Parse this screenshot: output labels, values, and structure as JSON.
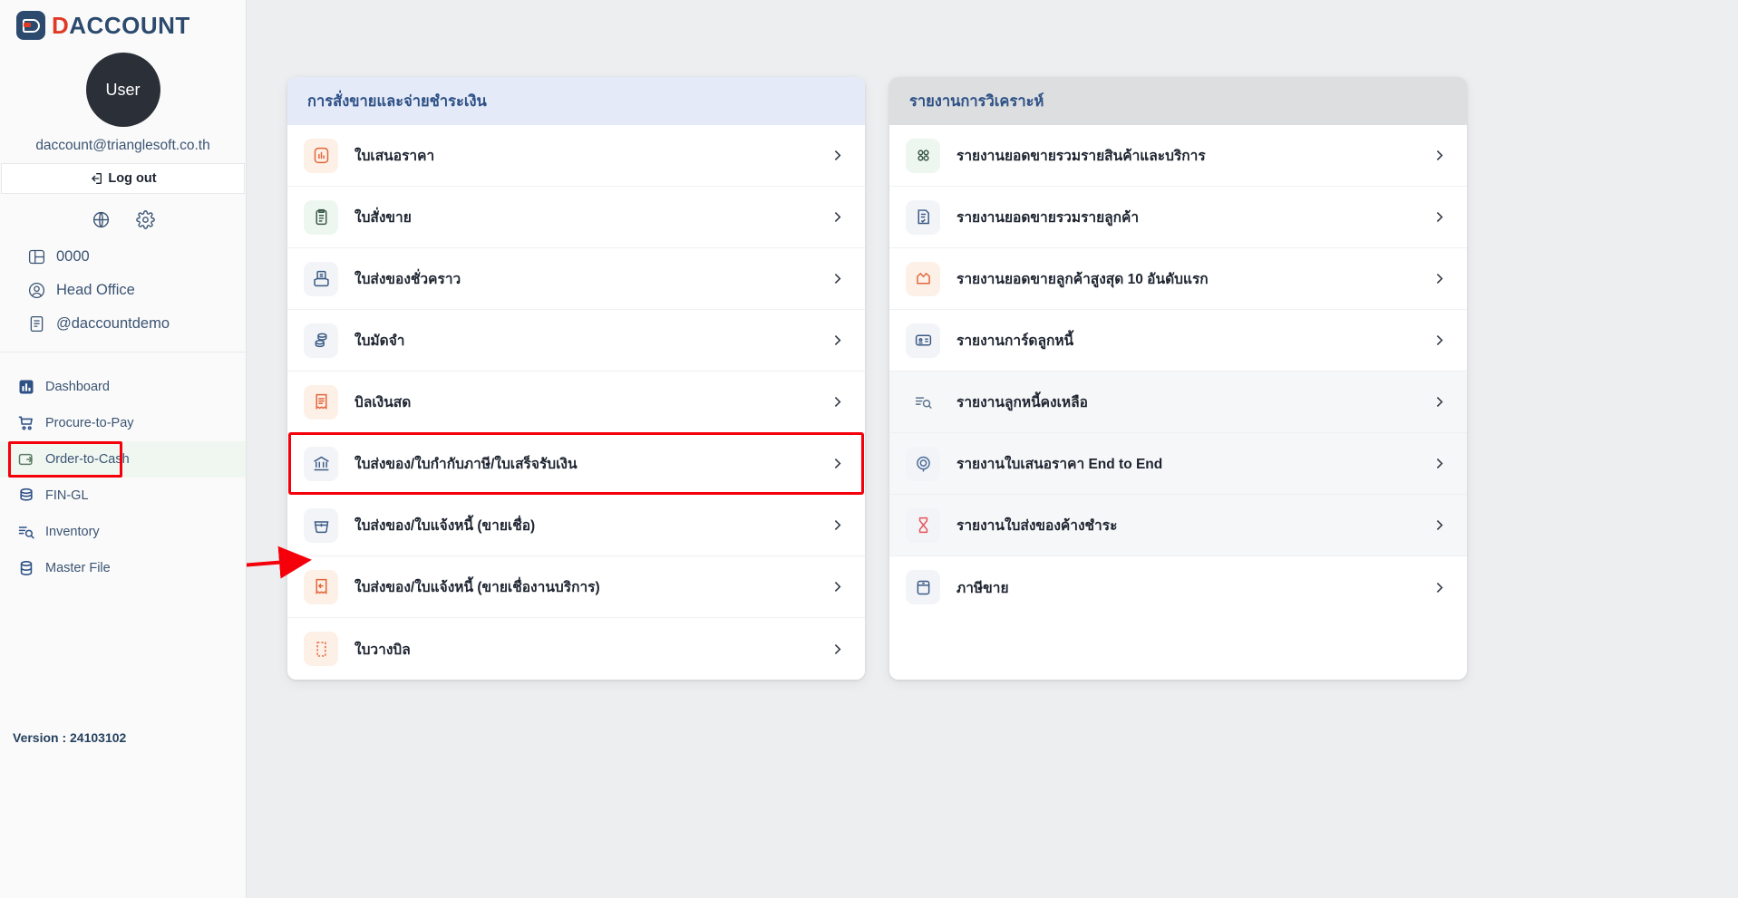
{
  "brand": {
    "d": "D",
    "rest": "ACCOUNT"
  },
  "account": {
    "avatar_label": "User",
    "email": "daccount@trianglesoft.co.th",
    "logout_label": "Log out"
  },
  "sidebar": {
    "top_icons": [
      {
        "name": "globe-icon"
      },
      {
        "name": "gear-icon"
      }
    ],
    "org_items": [
      {
        "icon": "layout-icon",
        "label": "0000"
      },
      {
        "icon": "user-circle-icon",
        "label": "Head Office"
      },
      {
        "icon": "document-icon",
        "label": "@daccountdemo"
      }
    ],
    "nav_items": [
      {
        "icon": "dashboard-icon",
        "label": "Dashboard",
        "active": false,
        "outlined": false
      },
      {
        "icon": "cart-icon",
        "label": "Procure-to-Pay",
        "active": false,
        "outlined": false
      },
      {
        "icon": "wallet-icon",
        "label": "Order-to-Cash",
        "active": true,
        "outlined": true
      },
      {
        "icon": "coins-icon",
        "label": "FIN-GL",
        "active": false,
        "outlined": false
      },
      {
        "icon": "inventory-icon",
        "label": "Inventory",
        "active": false,
        "outlined": false
      },
      {
        "icon": "database-icon",
        "label": "Master File",
        "active": false,
        "outlined": false
      }
    ],
    "version": "Version : 24103102"
  },
  "cards": [
    {
      "id": "sales-order-payment",
      "title": "การสั่งขายและจ่ายชำระเงิน",
      "head_style": "blue",
      "rows": [
        {
          "icon": "bar-chart-doc-icon",
          "tile": "peach",
          "stroke": "#e4663a",
          "label": "ใบเสนอราคา",
          "tint": false,
          "highlight": false
        },
        {
          "icon": "clipboard-list-icon",
          "tile": "mint",
          "stroke": "#3d5a4a",
          "label": "ใบสั่งขาย",
          "tint": false,
          "highlight": false
        },
        {
          "icon": "inbox-doc-icon",
          "tile": "slate",
          "stroke": "#3b5a86",
          "label": "ใบส่งของชั่วคราว",
          "tint": false,
          "highlight": false
        },
        {
          "icon": "coins-stack-icon",
          "tile": "slate",
          "stroke": "#3b5a86",
          "label": "ใบมัดจำ",
          "tint": false,
          "highlight": false
        },
        {
          "icon": "receipt-lines-icon",
          "tile": "peach",
          "stroke": "#e4663a",
          "label": "บิลเงินสด",
          "tint": false,
          "highlight": false
        },
        {
          "icon": "bank-icon",
          "tile": "slate",
          "stroke": "#3b5a86",
          "label": "ใบส่งของ/ใบกำกับภาษี/ใบเสร็จรับเงิน",
          "tint": false,
          "highlight": true
        },
        {
          "icon": "basket-icon",
          "tile": "slate",
          "stroke": "#3b5a86",
          "label": "ใบส่งของ/ใบแจ้งหนี้ (ขายเชื่อ)",
          "tint": false,
          "highlight": false
        },
        {
          "icon": "return-doc-icon",
          "tile": "peach",
          "stroke": "#e4663a",
          "label": "ใบส่งของ/ใบแจ้งหนี้ (ขายเชื่องานบริการ)",
          "tint": false,
          "highlight": false
        },
        {
          "icon": "dashed-doc-icon",
          "tile": "peach",
          "stroke": "#e4663a",
          "label": "ใบวางบิล",
          "tint": false,
          "highlight": false
        }
      ]
    },
    {
      "id": "analysis-reports",
      "title": "รายงานการวิเคราะห์",
      "head_style": "gray",
      "rows": [
        {
          "icon": "four-dots-icon",
          "tile": "mint",
          "stroke": "#3d5a4a",
          "label": "รายงานยอดขายรวมรายสินค้าและบริการ",
          "tint": false,
          "highlight": false
        },
        {
          "icon": "doc-check-icon",
          "tile": "slate",
          "stroke": "#3b5a86",
          "label": "รายงานยอดขายรวมรายลูกค้า",
          "tint": false,
          "highlight": false
        },
        {
          "icon": "crown-icon",
          "tile": "peach",
          "stroke": "#e4663a",
          "label": "รายงานยอดขายลูกค้าสูงสุด 10 อันดับแรก",
          "tint": false,
          "highlight": false
        },
        {
          "icon": "id-card-icon",
          "tile": "slate",
          "stroke": "#3b5a86",
          "label": "รายงานการ์ดลูกหนี้",
          "tint": false,
          "highlight": false
        },
        {
          "icon": "list-search-icon",
          "tile": "plain",
          "stroke": "#5c748f",
          "label": "รายงานลูกหนี้คงเหลือ",
          "tint": true,
          "highlight": false
        },
        {
          "icon": "spiral-icon",
          "tile": "slate",
          "stroke": "#4a6b96",
          "label": "รายงานใบเสนอราคา End to End",
          "tint": true,
          "highlight": false
        },
        {
          "icon": "hourglass-icon",
          "tile": "slate",
          "stroke": "#e8535b",
          "label": "รายงานใบส่งของค้างชำระ",
          "tint": true,
          "highlight": false
        },
        {
          "icon": "archive-icon",
          "tile": "slate",
          "stroke": "#3b5a86",
          "label": "ภาษีขาย",
          "tint": false,
          "highlight": false
        }
      ]
    }
  ],
  "annotations": {
    "arrow_color": "#f5000a",
    "highlight_color": "#f5000a"
  }
}
